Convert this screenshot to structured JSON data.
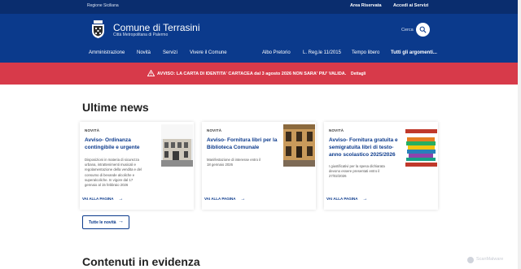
{
  "slim_header": {
    "region": "Regione Siciliana",
    "area": "Area Riservata",
    "access": "Accedi ai Servizi"
  },
  "brand": {
    "title": "Comune di Terrasini",
    "subtitle": "Città Metropolitana di Palermo"
  },
  "search": {
    "label": "Cerca"
  },
  "nav": {
    "items": [
      "Amministrazione",
      "Novità",
      "Servizi",
      "Vivere il Comune"
    ],
    "secondary": [
      "Albo Pretorio",
      "L. Reg.le 11/2015",
      "Tempo libero"
    ],
    "all_topics": "Tutti gli argomenti..."
  },
  "alert": {
    "text": "AVVISO: LA CARTA DI IDENTITA' CARTACEA dal 3 agosto 2026 NON SARA' PIU' VALIDA.",
    "details": "Dettagli"
  },
  "news": {
    "section_title": "Ultime news",
    "cards": [
      {
        "category": "NOVITÀ",
        "title_lines": [
          "Avviso- Ordinanza",
          "contingibile e urgente"
        ],
        "body_lines": [
          "Disposizioni in materia di sicurezza",
          "urbana, intrattenimenti musicali e",
          "regolamentazione della vendita e del",
          "consumo di bevande alcoliche e",
          "superalcoliche. In vigore dal 17",
          "gennaio al 15 febbraio 2026"
        ],
        "link": "VAI ALLA PAGINA"
      },
      {
        "category": "NOVITÀ",
        "title_lines": [
          "Avviso- Fornitura libri per la",
          "Biblioteca Comunale"
        ],
        "body_lines": [
          "Manifestazione di interesse entro il",
          "18 gennaio 2026"
        ],
        "link": "VAI ALLA PAGINA"
      },
      {
        "category": "NOVITÀ",
        "title_lines": [
          "Avviso- Fornitura gratuita e",
          "semigratuita libri di testo-",
          "anno scolastico 2025/2026"
        ],
        "body_lines": [
          "I giustificativi per la spesa dichiarata",
          "devono essere presentati entro il",
          "27/02/2026"
        ],
        "link": "VAI ALLA PAGINA"
      }
    ],
    "all_news": "Tutte le novità"
  },
  "featured": {
    "section_title": "Contenuti in evidenza"
  },
  "watermark": "ScanMalware",
  "colors": {
    "primary": "#0b3a8c",
    "slim": "#0a2d6e",
    "alert": "#d73a4a"
  }
}
